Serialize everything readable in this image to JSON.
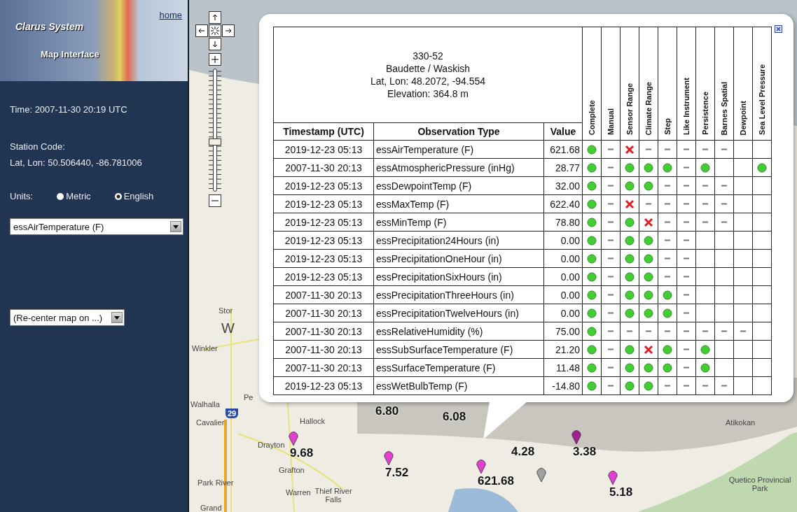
{
  "sidebar": {
    "title": "Clarus System",
    "subtitle": "Map Interface",
    "home_link": "home",
    "time": "Time: 2007-11-30 20:19 UTC",
    "station_code": "Station Code:",
    "lat_lon": "Lat, Lon: 50.506440, -86.781006",
    "units": {
      "label": "Units:",
      "options": [
        {
          "label": "Metric",
          "selected": false
        },
        {
          "label": "English",
          "selected": true
        }
      ]
    },
    "observation_select": "essAirTemperature (F)",
    "recenter_select": "(Re-center map on ...)"
  },
  "map": {
    "zoom": {
      "level": 0.41
    },
    "places": [
      {
        "name": "Stor"
      },
      {
        "name": "W"
      },
      {
        "name": "Winkler"
      },
      {
        "name": "Pe"
      },
      {
        "name": "Walhalla"
      },
      {
        "name": "Cavalier"
      },
      {
        "name": "29"
      },
      {
        "name": "Hallock"
      },
      {
        "name": "Drayton"
      },
      {
        "name": "Grafton"
      },
      {
        "name": "Park River"
      },
      {
        "name": "Warren"
      },
      {
        "name": "Thief River Falls"
      },
      {
        "name": "Grand"
      },
      {
        "name": "Atikokan"
      },
      {
        "name": "Quetico Provincial Park"
      }
    ],
    "markers": [
      {
        "kind": "label",
        "label": "6.80"
      },
      {
        "kind": "label",
        "label": "6.08"
      },
      {
        "kind": "pin",
        "label": "9.68",
        "color": "#e040d0"
      },
      {
        "kind": "pin",
        "label": "7.52",
        "color": "#e040d0"
      },
      {
        "kind": "label",
        "label": "4.28"
      },
      {
        "kind": "pin",
        "label": "3.38",
        "color": "#a02090"
      },
      {
        "kind": "pin",
        "label": "621.68",
        "color": "#e040d0"
      },
      {
        "kind": "pin",
        "color": "#a0a0a0"
      },
      {
        "kind": "pin",
        "label": "5.18",
        "color": "#e040d0"
      }
    ]
  },
  "popup": {
    "station": {
      "code": "330-52",
      "name": "Baudette / Waskish",
      "lat_lon": "Lat, Lon: 48.2072, -94.554",
      "elevation": "Elevation: 364.8 m"
    },
    "columns": [
      "Timestamp (UTC)",
      "Observation Type",
      "Value"
    ],
    "flag_columns": [
      "Complete",
      "Manual",
      "Sensor Range",
      "Climate Range",
      "Step",
      "Like Instrument",
      "Persistence",
      "Barnes Spatial",
      "Dewpoint",
      "Sea Level Pressure"
    ],
    "rows": [
      {
        "timestamp": "2019-12-23 05:13",
        "type": "essAirTemperature (F)",
        "value": "621.68",
        "flags": [
          {
            "kind": "pass"
          },
          {
            "kind": "skipped"
          },
          {
            "kind": "fail"
          },
          {
            "kind": "skipped"
          },
          {
            "kind": "skipped"
          },
          {
            "kind": "skipped"
          },
          {
            "kind": "skipped"
          },
          {
            "kind": "skipped"
          },
          {
            "kind": "empty"
          },
          {
            "kind": "empty"
          }
        ]
      },
      {
        "timestamp": "2007-11-30 20:13",
        "type": "essAtmosphericPressure (inHg)",
        "value": "28.77",
        "flags": [
          {
            "kind": "pass"
          },
          {
            "kind": "skipped"
          },
          {
            "kind": "pass"
          },
          {
            "kind": "pass"
          },
          {
            "kind": "pass"
          },
          {
            "kind": "skipped"
          },
          {
            "kind": "pass"
          },
          {
            "kind": "empty"
          },
          {
            "kind": "empty"
          },
          {
            "kind": "pass"
          }
        ]
      },
      {
        "timestamp": "2019-12-23 05:13",
        "type": "essDewpointTemp (F)",
        "value": "32.00",
        "flags": [
          {
            "kind": "pass"
          },
          {
            "kind": "skipped"
          },
          {
            "kind": "pass"
          },
          {
            "kind": "pass"
          },
          {
            "kind": "skipped"
          },
          {
            "kind": "skipped"
          },
          {
            "kind": "skipped"
          },
          {
            "kind": "skipped"
          },
          {
            "kind": "empty"
          },
          {
            "kind": "empty"
          }
        ]
      },
      {
        "timestamp": "2019-12-23 05:13",
        "type": "essMaxTemp (F)",
        "value": "622.40",
        "flags": [
          {
            "kind": "pass"
          },
          {
            "kind": "skipped"
          },
          {
            "kind": "fail"
          },
          {
            "kind": "skipped"
          },
          {
            "kind": "skipped"
          },
          {
            "kind": "skipped"
          },
          {
            "kind": "skipped"
          },
          {
            "kind": "skipped"
          },
          {
            "kind": "empty"
          },
          {
            "kind": "empty"
          }
        ]
      },
      {
        "timestamp": "2019-12-23 05:13",
        "type": "essMinTemp (F)",
        "value": "78.80",
        "flags": [
          {
            "kind": "pass"
          },
          {
            "kind": "skipped"
          },
          {
            "kind": "pass"
          },
          {
            "kind": "fail"
          },
          {
            "kind": "skipped"
          },
          {
            "kind": "skipped"
          },
          {
            "kind": "skipped"
          },
          {
            "kind": "skipped"
          },
          {
            "kind": "empty"
          },
          {
            "kind": "empty"
          }
        ]
      },
      {
        "timestamp": "2019-12-23 05:13",
        "type": "essPrecipitation24Hours (in)",
        "value": "0.00",
        "flags": [
          {
            "kind": "pass"
          },
          {
            "kind": "skipped"
          },
          {
            "kind": "pass"
          },
          {
            "kind": "pass"
          },
          {
            "kind": "skipped"
          },
          {
            "kind": "skipped"
          },
          {
            "kind": "empty"
          },
          {
            "kind": "empty"
          },
          {
            "kind": "empty"
          },
          {
            "kind": "empty"
          }
        ]
      },
      {
        "timestamp": "2019-12-23 05:13",
        "type": "essPrecipitationOneHour (in)",
        "value": "0.00",
        "flags": [
          {
            "kind": "pass"
          },
          {
            "kind": "skipped"
          },
          {
            "kind": "pass"
          },
          {
            "kind": "pass"
          },
          {
            "kind": "skipped"
          },
          {
            "kind": "skipped"
          },
          {
            "kind": "empty"
          },
          {
            "kind": "empty"
          },
          {
            "kind": "empty"
          },
          {
            "kind": "empty"
          }
        ]
      },
      {
        "timestamp": "2019-12-23 05:13",
        "type": "essPrecipitationSixHours (in)",
        "value": "0.00",
        "flags": [
          {
            "kind": "pass"
          },
          {
            "kind": "skipped"
          },
          {
            "kind": "pass"
          },
          {
            "kind": "pass"
          },
          {
            "kind": "skipped"
          },
          {
            "kind": "skipped"
          },
          {
            "kind": "empty"
          },
          {
            "kind": "empty"
          },
          {
            "kind": "empty"
          },
          {
            "kind": "empty"
          }
        ]
      },
      {
        "timestamp": "2007-11-30 20:13",
        "type": "essPrecipitationThreeHours (in)",
        "value": "0.00",
        "flags": [
          {
            "kind": "pass"
          },
          {
            "kind": "skipped"
          },
          {
            "kind": "pass"
          },
          {
            "kind": "pass"
          },
          {
            "kind": "pass"
          },
          {
            "kind": "skipped"
          },
          {
            "kind": "empty"
          },
          {
            "kind": "empty"
          },
          {
            "kind": "empty"
          },
          {
            "kind": "empty"
          }
        ]
      },
      {
        "timestamp": "2007-11-30 20:13",
        "type": "essPrecipitationTwelveHours (in)",
        "value": "0.00",
        "flags": [
          {
            "kind": "pass"
          },
          {
            "kind": "skipped"
          },
          {
            "kind": "pass"
          },
          {
            "kind": "pass"
          },
          {
            "kind": "pass"
          },
          {
            "kind": "skipped"
          },
          {
            "kind": "empty"
          },
          {
            "kind": "empty"
          },
          {
            "kind": "empty"
          },
          {
            "kind": "empty"
          }
        ]
      },
      {
        "timestamp": "2007-11-30 20:13",
        "type": "essRelativeHumidity (%)",
        "value": "75.00",
        "flags": [
          {
            "kind": "pass"
          },
          {
            "kind": "skipped"
          },
          {
            "kind": "skipped"
          },
          {
            "kind": "skipped"
          },
          {
            "kind": "skipped"
          },
          {
            "kind": "skipped"
          },
          {
            "kind": "skipped"
          },
          {
            "kind": "skipped"
          },
          {
            "kind": "skipped"
          },
          {
            "kind": "empty"
          }
        ]
      },
      {
        "timestamp": "2007-11-30 20:13",
        "type": "essSubSurfaceTemperature (F)",
        "value": "21.20",
        "flags": [
          {
            "kind": "pass"
          },
          {
            "kind": "skipped"
          },
          {
            "kind": "pass"
          },
          {
            "kind": "fail"
          },
          {
            "kind": "pass"
          },
          {
            "kind": "skipped"
          },
          {
            "kind": "pass"
          },
          {
            "kind": "empty"
          },
          {
            "kind": "empty"
          },
          {
            "kind": "empty"
          }
        ]
      },
      {
        "timestamp": "2007-11-30 20:13",
        "type": "essSurfaceTemperature (F)",
        "value": "11.48",
        "flags": [
          {
            "kind": "pass"
          },
          {
            "kind": "skipped"
          },
          {
            "kind": "pass"
          },
          {
            "kind": "pass"
          },
          {
            "kind": "pass"
          },
          {
            "kind": "skipped"
          },
          {
            "kind": "pass"
          },
          {
            "kind": "empty"
          },
          {
            "kind": "empty"
          },
          {
            "kind": "empty"
          }
        ]
      },
      {
        "timestamp": "2019-12-23 05:13",
        "type": "essWetBulbTemp (F)",
        "value": "-14.80",
        "flags": [
          {
            "kind": "pass"
          },
          {
            "kind": "skipped"
          },
          {
            "kind": "pass"
          },
          {
            "kind": "pass"
          },
          {
            "kind": "skipped"
          },
          {
            "kind": "skipped"
          },
          {
            "kind": "skipped"
          },
          {
            "kind": "skipped"
          },
          {
            "kind": "empty"
          },
          {
            "kind": "empty"
          }
        ]
      }
    ]
  }
}
